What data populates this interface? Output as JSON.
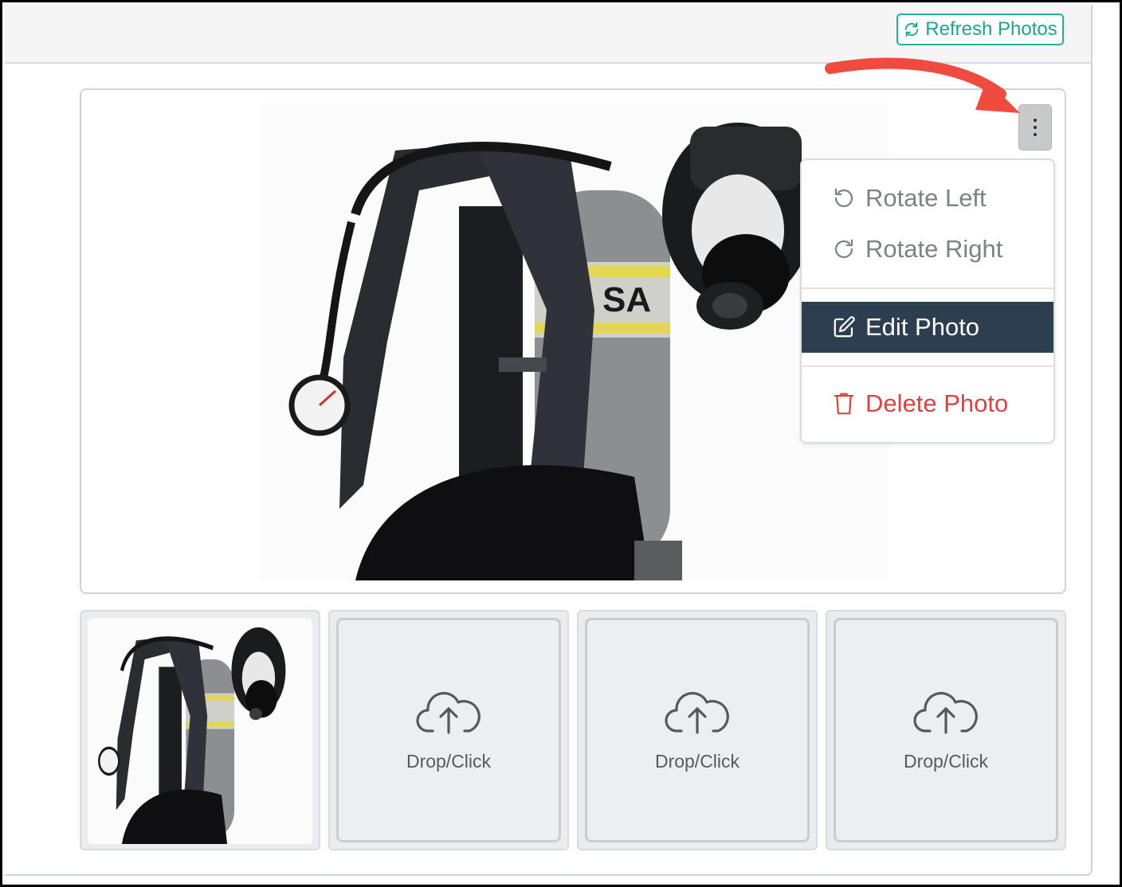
{
  "header": {
    "refresh_label": "Refresh Photos"
  },
  "menu": {
    "rotate_left": "Rotate Left",
    "rotate_right": "Rotate Right",
    "edit_photo": "Edit Photo",
    "delete_photo": "Delete Photo"
  },
  "upload_slots": [
    {
      "label": "Drop/Click"
    },
    {
      "label": "Drop/Click"
    },
    {
      "label": "Drop/Click"
    }
  ],
  "colors": {
    "accent_teal": "#1fb39a",
    "edit_highlight": "#2c3e50",
    "delete_red": "#d64541",
    "annotation_arrow": "#ef4b3f"
  },
  "icons": {
    "refresh": "refresh-icon",
    "menu": "kebab-menu-icon",
    "rotate_left": "rotate-left-icon",
    "rotate_right": "rotate-right-icon",
    "edit": "edit-pencil-icon",
    "delete": "trash-icon",
    "upload": "cloud-upload-icon"
  }
}
